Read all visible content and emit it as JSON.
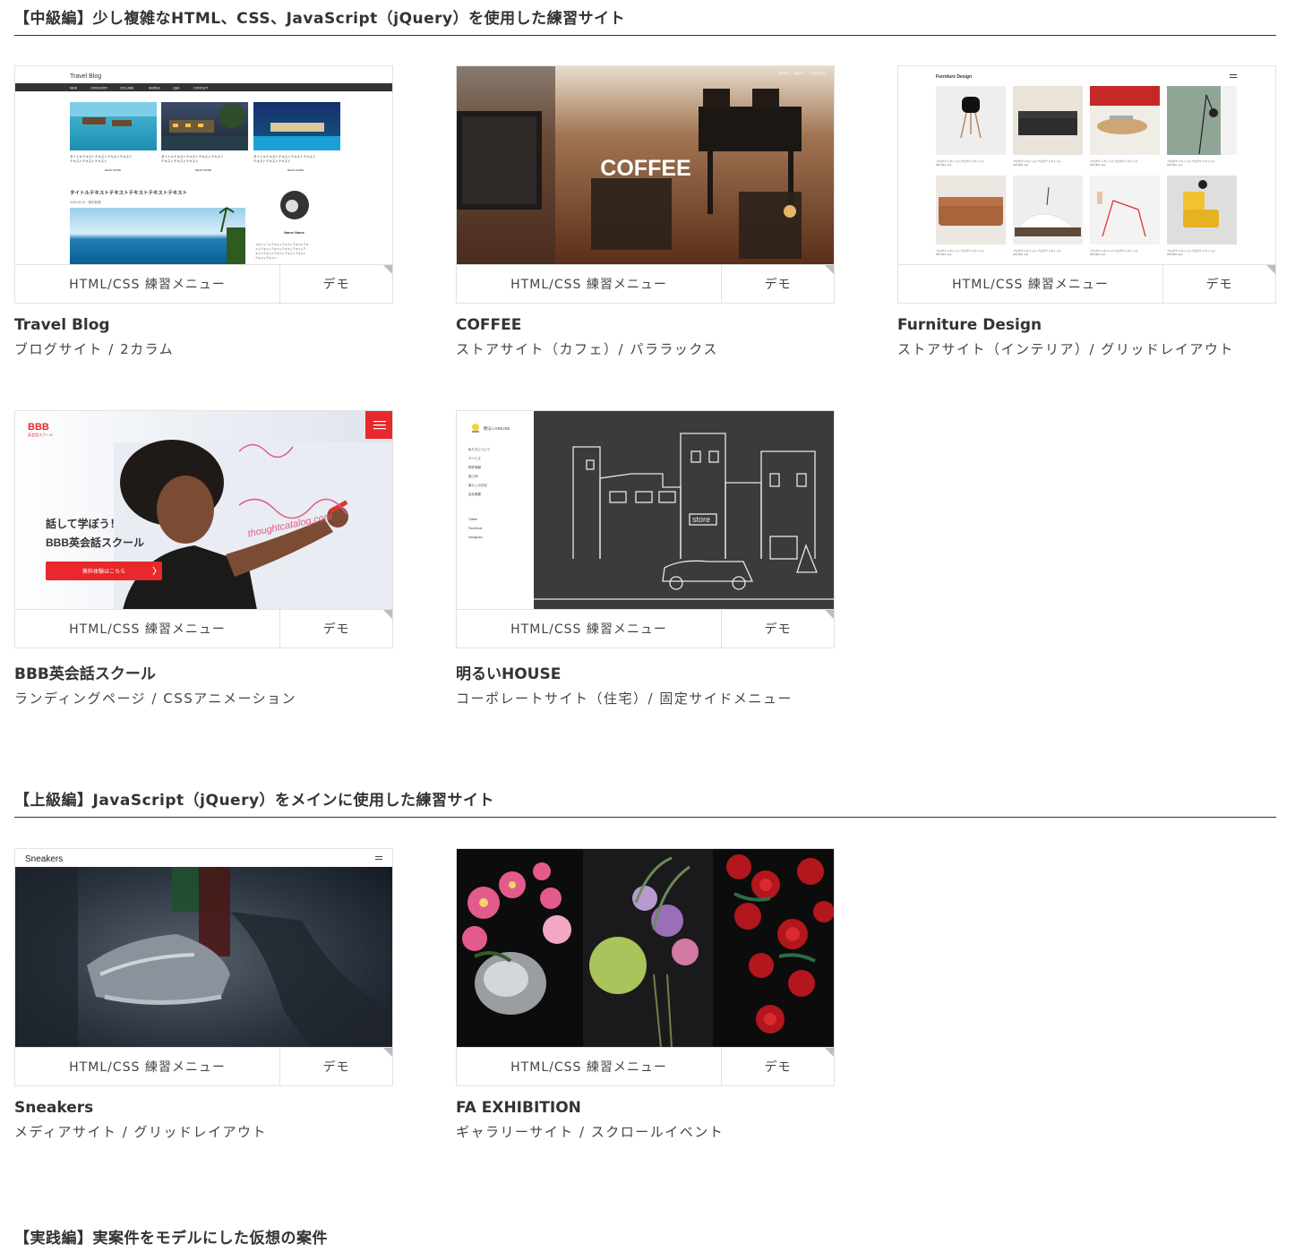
{
  "sections": [
    {
      "heading": "【中級編】少し複雑なHTML、CSS、JavaScript（jQuery）を使用した練習サイト"
    },
    {
      "heading": "【上級編】JavaScript（jQuery）をメインに使用した練習サイト"
    },
    {
      "heading": "【実践編】実案件をモデルにした仮想の案件"
    }
  ],
  "buttons": {
    "menu": "HTML/CSS 練習メニュー",
    "demo": "デモ"
  },
  "cards": [
    {
      "title": "Travel Blog",
      "desc": "ブログサイト / 2カラム",
      "preview": {
        "site_title": "Travel Blog",
        "nav": [
          "NEW",
          "CATEGORY",
          "COLUMN",
          "SERIES",
          "Q&A",
          "CONTACT"
        ],
        "post_text": "タイトルテキストテキストテキストテキストテキストテキストテキストテキスト",
        "read_more": "READ MORE",
        "main_title": "タイトルテキストテキストテキストテキストテキスト",
        "date": "2020.01.01  ·  旅行記録",
        "profile_name": "Name Name",
        "profile_text": "プロフィールテキストテキストテキストテキストテキストテキストテキストテキスト"
      }
    },
    {
      "title": "COFFEE",
      "desc": "ストアサイト（カフェ）/ パララックス",
      "preview": {
        "hero_text": "COFFEE",
        "nav": [
          "MENU",
          "ABOUT",
          "LOCATION"
        ]
      }
    },
    {
      "title": "Furniture Design",
      "desc": "ストアサイト（インテリア）/ グリッドレイアウト",
      "preview": {
        "site_title": "Furniture Design",
        "product_name": "プロダクトタイトルプロダクトタイトル",
        "price": "¥00,000 +tax"
      }
    },
    {
      "title": "BBB英会話スクール",
      "desc": "ランディングページ / CSSアニメーション",
      "preview": {
        "logo": "BBB",
        "logo_sub": "英会話スクール",
        "hero_line1": "話して学ぼう！",
        "hero_line2": "BBB英会話スクール",
        "cta": "無料体験はこちら",
        "board_text": "thoughtcatalog.com"
      }
    },
    {
      "title": "明るいHOUSE",
      "desc": "コーポレートサイト（住宅）/ 固定サイドメニュー",
      "preview": {
        "logo": "明るいHOUSE",
        "menu": [
          "私たちについて",
          "サービス",
          "物件情報",
          "施工例",
          "暮らしの日記",
          "会社概要"
        ],
        "social": [
          "Twitter",
          "Facebook",
          "Instagram"
        ],
        "store_sign": "store"
      }
    },
    {
      "title": "Sneakers",
      "desc": "メディアサイト / グリッドレイアウト",
      "preview": {
        "site_title": "Sneakers"
      }
    },
    {
      "title": "FA EXHIBITION",
      "desc": "ギャラリーサイト / スクロールイベント",
      "preview": {}
    }
  ],
  "colors": {
    "accent_red": "#e8282b",
    "text": "#333333",
    "border": "#e2e2e2"
  }
}
